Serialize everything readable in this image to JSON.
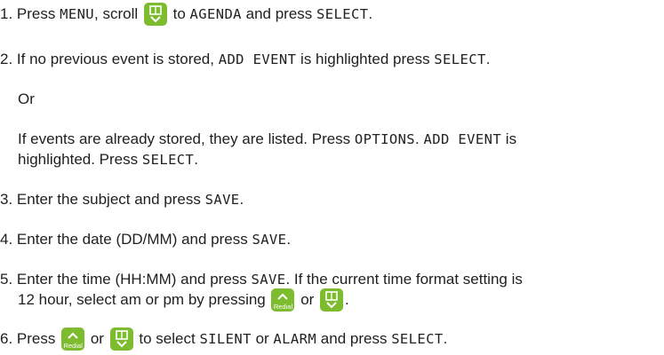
{
  "steps": [
    {
      "num": "1.",
      "t1": "Press ",
      "k1": "MENU",
      "t2": ", scroll ",
      "t3": " to ",
      "k2": "AGENDA",
      "t4": " and press ",
      "k3": "SELECT",
      "t5": "."
    },
    {
      "num": "2.",
      "t1": "If no previous event is stored, ",
      "k1": "ADD EVENT",
      "t2": " is highlighted press ",
      "k2": "SELECT",
      "t3": "."
    },
    {
      "or": "Or"
    },
    {
      "t1": "If events are already stored, they are listed. Press ",
      "k1": "OPTIONS",
      "t2": ". ",
      "k2": "ADD EVENT",
      "t3": " is",
      "line2": "highlighted. Press ",
      "k3": "SELECT",
      "t4": "."
    },
    {
      "num": "3.",
      "t1": "Enter the subject and press ",
      "k1": "SAVE",
      "t2": "."
    },
    {
      "num": "4.",
      "t1": "Enter the date (DD/MM) and press ",
      "k1": "SAVE",
      "t2": "."
    },
    {
      "num": "5.",
      "t1": "Enter the time (HH:MM) and press ",
      "k1": "SAVE",
      "t2": ". If the current time format setting is",
      "line2": "12 hour, select am or pm by pressing ",
      "t3": " or ",
      "t4": "."
    },
    {
      "num": "6.",
      "t1": "Press ",
      "t2": " or ",
      "t3": " to select ",
      "k1": "SILENT",
      "t4": " or ",
      "k2": "ALARM",
      "t5": " and press ",
      "k3": "SELECT",
      "t6": "."
    }
  ],
  "keys": {
    "redial_label": "Redial"
  },
  "icons": {
    "down": "phonebook-down-key-icon",
    "up": "redial-up-key-icon"
  },
  "colors": {
    "key_green": "#7dbb2f",
    "text": "#1f1f1f"
  }
}
